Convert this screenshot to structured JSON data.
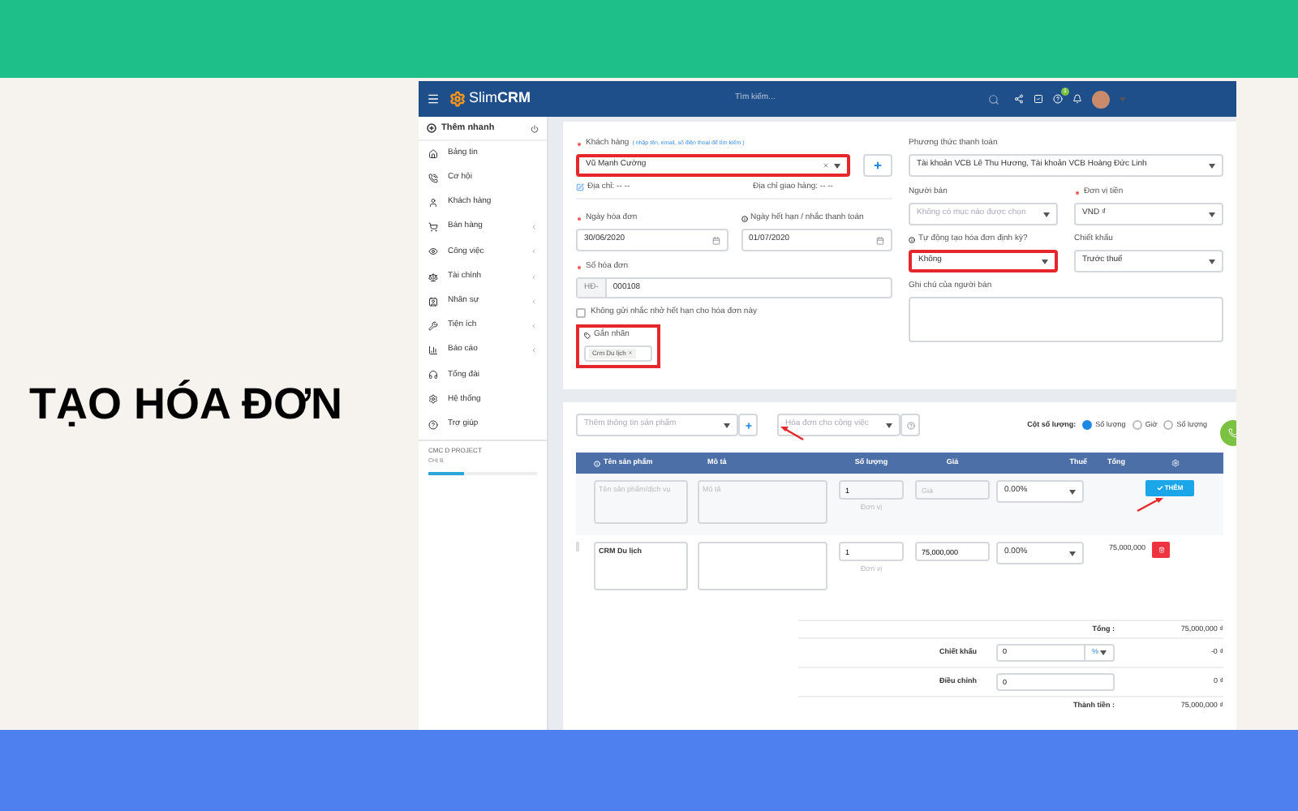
{
  "slide_title": "TẠO HÓA ĐƠN",
  "topbar": {
    "logo_light": "Slim",
    "logo_bold": "CRM",
    "search_placeholder": "Tìm kiếm...",
    "help_badge": "1"
  },
  "sidebar": {
    "quick_add": "Thêm nhanh",
    "items": [
      {
        "label": "Bảng tin",
        "has_submenu": false
      },
      {
        "label": "Cơ hội",
        "has_submenu": false
      },
      {
        "label": "Khách hàng",
        "has_submenu": false
      },
      {
        "label": "Bán hàng",
        "has_submenu": true
      },
      {
        "label": "Công việc",
        "has_submenu": true
      },
      {
        "label": "Tài chính",
        "has_submenu": true
      },
      {
        "label": "Nhân sự",
        "has_submenu": true
      },
      {
        "label": "Tiện ích",
        "has_submenu": true
      },
      {
        "label": "Báo cáo",
        "has_submenu": true
      },
      {
        "label": "Tổng đài",
        "has_submenu": false
      },
      {
        "label": "Hệ thống",
        "has_submenu": false
      },
      {
        "label": "Trợ giúp",
        "has_submenu": false
      }
    ],
    "project": {
      "name": "CMC D PROJECT",
      "owner": "CHỊ B",
      "level": 0.33
    }
  },
  "invoice": {
    "customer": {
      "label": "Khách hàng",
      "required": true,
      "hint": "( nhập tên, email, số điện thoại để tìm kiếm )",
      "value": "Vũ Mạnh Cường",
      "highlighted": true
    },
    "address": "Địa chỉ: -- --",
    "shipping_address": "Địa chỉ giao hàng: -- --",
    "invoice_date": {
      "label": "Ngày hóa đơn",
      "required": true,
      "value": "30/06/2020"
    },
    "due_date": {
      "label": "Ngày hết hạn / nhắc thanh toán",
      "required": false,
      "value": "01/07/2020"
    },
    "invoice_number": {
      "label": "Số hóa đơn",
      "required": true,
      "prefix": "HĐ-",
      "value": "000108"
    },
    "no_reminder": {
      "label": "Không gửi nhắc nhở hết hạn cho hóa đơn này",
      "checked": false
    },
    "tags": {
      "label": "Gắn nhãn",
      "highlighted": true,
      "items": [
        "Crm Du lịch"
      ]
    },
    "payment_method": {
      "label": "Phương thức thanh toán",
      "value": "Tài khoản VCB Lê Thu Hương, Tài khoản VCB Hoàng Đức Linh"
    },
    "seller": {
      "label": "Người bán",
      "placeholder": "Không có mục nào được chọn"
    },
    "currency": {
      "label": "Đơn vị tiền",
      "required": true,
      "value": "VND ₫"
    },
    "recurring": {
      "label": "Tự động tạo hóa đơn định kỳ?",
      "value": "Không",
      "highlighted": true
    },
    "discount_type": {
      "label": "Chiết khấu",
      "value": "Trước thuế"
    },
    "seller_note": {
      "label": "Ghi chú của người bán"
    }
  },
  "items_section": {
    "product_select": {
      "placeholder": "Thêm thông tin sản phẩm"
    },
    "job_select": {
      "placeholder": "Hóa đơn cho công việc"
    },
    "quantity_column": {
      "label": "Cột số lượng:",
      "options": [
        {
          "label": "Số lượng",
          "selected": true
        },
        {
          "label": "Giờ",
          "selected": false
        },
        {
          "label": "Số lượng",
          "selected": false
        }
      ]
    },
    "columns": [
      "Tên sản phẩm",
      "Mô tả",
      "Số lượng",
      "Giá",
      "Thuế",
      "Tổng"
    ],
    "new_row": {
      "name_placeholder": "Tên sản phẩm/dịch vụ",
      "description_placeholder": "Mô tả",
      "quantity": "1",
      "unit_placeholder": "Đơn vị",
      "price_placeholder": "Giá",
      "tax": "0.00%",
      "add_button": "THÊM"
    },
    "rows": [
      {
        "name": "CRM Du lịch",
        "quantity": "1",
        "unit_placeholder": "Đơn vị",
        "price": "75,000,000",
        "tax": "0.00%",
        "total": "75,000,000"
      }
    ],
    "totals": {
      "subtotal_label": "Tổng :",
      "subtotal": "75,000,000 ₫",
      "discount_label": "Chiết khấu",
      "discount_input": "0",
      "discount_unit": "%",
      "discount_value": "-0 ₫",
      "adjustment_label": "Điều chỉnh",
      "adjustment_input": "0",
      "adjustment_value": "0 ₫",
      "total_label": "Thành tiền :",
      "total": "75,000,000 ₫"
    }
  }
}
